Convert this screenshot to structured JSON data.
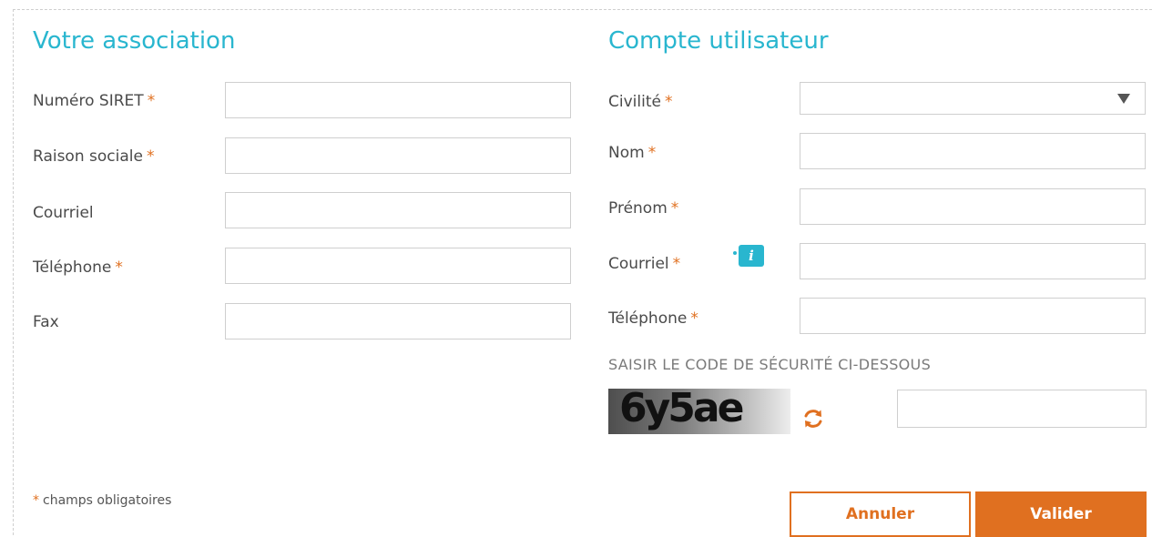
{
  "association": {
    "title": "Votre association",
    "fields": {
      "siret": {
        "label": "Numéro SIRET",
        "required_mark": "*",
        "value": ""
      },
      "raison": {
        "label": "Raison sociale",
        "required_mark": "*",
        "value": ""
      },
      "courriel": {
        "label": "Courriel",
        "value": ""
      },
      "telephone": {
        "label": "Téléphone",
        "required_mark": "*",
        "value": ""
      },
      "fax": {
        "label": "Fax",
        "value": ""
      }
    }
  },
  "account": {
    "title": "Compte utilisateur",
    "fields": {
      "civilite": {
        "label": "Civilité",
        "required_mark": "*",
        "selected": ""
      },
      "nom": {
        "label": "Nom",
        "required_mark": "*",
        "value": ""
      },
      "prenom": {
        "label": "Prénom",
        "required_mark": "*",
        "value": ""
      },
      "courriel": {
        "label": "Courriel",
        "required_mark": "*",
        "value": ""
      },
      "telephone": {
        "label": "Téléphone",
        "required_mark": "*",
        "value": ""
      }
    },
    "info_icon": "i"
  },
  "captcha": {
    "label": "SAISIR LE CODE DE SÉCURITÉ CI-DESSOUS",
    "code": "6y5ae",
    "value": ""
  },
  "footer": {
    "required_mark": "*",
    "required_note": "champs obligatoires"
  },
  "buttons": {
    "cancel": "Annuler",
    "submit": "Valider"
  },
  "colors": {
    "accent": "#29b6cf",
    "primary": "#e07020"
  },
  "icons": {
    "select": "chevron-down-icon",
    "info": "info-icon",
    "refresh": "refresh-icon"
  }
}
